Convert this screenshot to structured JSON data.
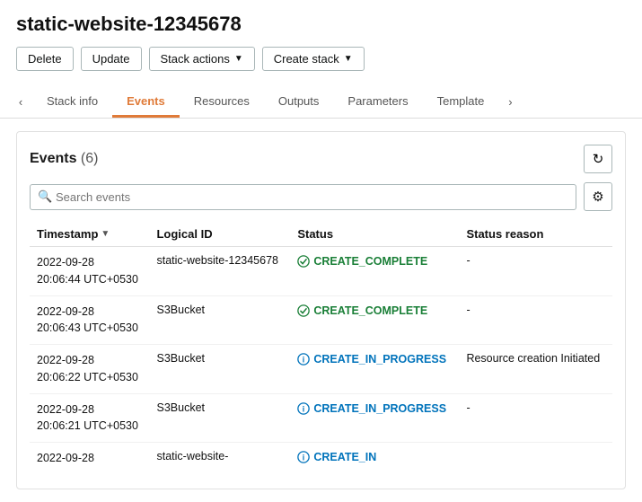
{
  "page": {
    "title": "static-website-12345678"
  },
  "toolbar": {
    "delete_label": "Delete",
    "update_label": "Update",
    "stack_actions_label": "Stack actions",
    "create_stack_label": "Create stack"
  },
  "tabs": {
    "prev_arrow": "‹",
    "next_arrow": "›",
    "items": [
      {
        "id": "stack-info",
        "label": "Stack info",
        "active": false
      },
      {
        "id": "events",
        "label": "Events",
        "active": true
      },
      {
        "id": "resources",
        "label": "Resources",
        "active": false
      },
      {
        "id": "outputs",
        "label": "Outputs",
        "active": false
      },
      {
        "id": "parameters",
        "label": "Parameters",
        "active": false
      },
      {
        "id": "template",
        "label": "Template",
        "active": false
      }
    ]
  },
  "events": {
    "section_title": "Events",
    "count_label": "(6)",
    "search_placeholder": "Search events",
    "refresh_icon": "↻",
    "settings_icon": "⚙",
    "search_icon": "🔍",
    "columns": {
      "timestamp": "Timestamp",
      "logical_id": "Logical ID",
      "status": "Status",
      "status_reason": "Status reason"
    },
    "rows": [
      {
        "timestamp": "2022-09-28\n20:06:44 UTC+0530",
        "logical_id": "static-website-12345678",
        "status_type": "complete",
        "status_text": "CREATE_COMPLETE",
        "status_reason": "-"
      },
      {
        "timestamp": "2022-09-28\n20:06:43 UTC+0530",
        "logical_id": "S3Bucket",
        "status_type": "complete",
        "status_text": "CREATE_COMPLETE",
        "status_reason": "-"
      },
      {
        "timestamp": "2022-09-28\n20:06:22 UTC+0530",
        "logical_id": "S3Bucket",
        "status_type": "inprogress",
        "status_text": "CREATE_IN_PROGRESS",
        "status_reason": "Resource creation Initiated"
      },
      {
        "timestamp": "2022-09-28\n20:06:21 UTC+0530",
        "logical_id": "S3Bucket",
        "status_type": "inprogress",
        "status_text": "CREATE_IN_PROGRESS",
        "status_reason": "-"
      },
      {
        "timestamp": "2022-09-28",
        "logical_id": "static-website-",
        "status_type": "inprogress",
        "status_text": "CREATE_IN",
        "status_reason": ""
      }
    ]
  }
}
